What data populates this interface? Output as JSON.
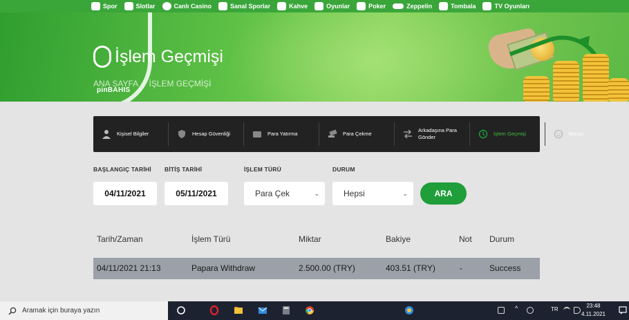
{
  "topnav": {
    "items": [
      {
        "label": "Spor",
        "icon": "soccer-ball-icon"
      },
      {
        "label": "Slotlar",
        "icon": "slot-machine-icon"
      },
      {
        "label": "Canlı Casino",
        "icon": "casino-chip-icon"
      },
      {
        "label": "Sanal Sporlar",
        "icon": "virtual-sports-icon"
      },
      {
        "label": "Kahve",
        "icon": "coffee-icon"
      },
      {
        "label": "Oyunlar",
        "icon": "dice-icon"
      },
      {
        "label": "Poker",
        "icon": "poker-icon"
      },
      {
        "label": "Zeppelin",
        "icon": "zeppelin-icon"
      },
      {
        "label": "Tombala",
        "icon": "bingo-icon"
      },
      {
        "label": "TV Oyunları",
        "icon": "tv-icon"
      }
    ]
  },
  "hero": {
    "title": "İşlem Geçmişi",
    "brand": "pinBAHIS",
    "breadcrumb": [
      "ANA SAYFA",
      "/",
      "İŞLEM GEÇMİŞİ"
    ]
  },
  "menu": {
    "items": [
      {
        "label": "Kişisel Bilgiler",
        "icon": "user-icon",
        "active": false
      },
      {
        "label": "Hesap Güvenliği",
        "icon": "shield-icon",
        "active": false
      },
      {
        "label": "Para Yatırma",
        "icon": "wallet-icon",
        "active": false
      },
      {
        "label": "Para Çekme",
        "icon": "cash-hand-icon",
        "active": false
      },
      {
        "label": "Arkadaşına Para Gönder",
        "icon": "transfer-arrows-icon",
        "active": false
      },
      {
        "label": "İşlem Geçmişi",
        "icon": "history-icon",
        "active": true
      },
      {
        "label": "Bonus",
        "icon": "smiley-icon",
        "active": false
      }
    ]
  },
  "filters": {
    "start_label": "BAŞLANGIÇ TARİHİ",
    "start_value": "04/11/2021",
    "end_label": "BİTİŞ TARİHİ",
    "end_value": "05/11/2021",
    "type_label": "İŞLEM TÜRÜ",
    "type_value": "Para Çek",
    "status_label": "DURUM",
    "status_value": "Hepsi",
    "search_button": "ARA"
  },
  "table": {
    "headers": [
      "Tarih/Zaman",
      "İşlem Türü",
      "Miktar",
      "Bakiye",
      "Not",
      "Durum"
    ],
    "rows": [
      [
        "04/11/2021 21:13",
        "Papara Withdraw",
        "2.500.00 (TRY)",
        "403.51 (TRY)",
        "-",
        "Success"
      ]
    ]
  },
  "taskbar": {
    "search_placeholder": "Aramak için buraya yazın",
    "ime": "TR",
    "time": "23:48",
    "date": "4.11.2021"
  },
  "colors": {
    "accent_green": "#1f9e3a",
    "nav_green": "#3aa63a",
    "menu_bg": "#222222",
    "row_bg": "#9ca0a8"
  }
}
